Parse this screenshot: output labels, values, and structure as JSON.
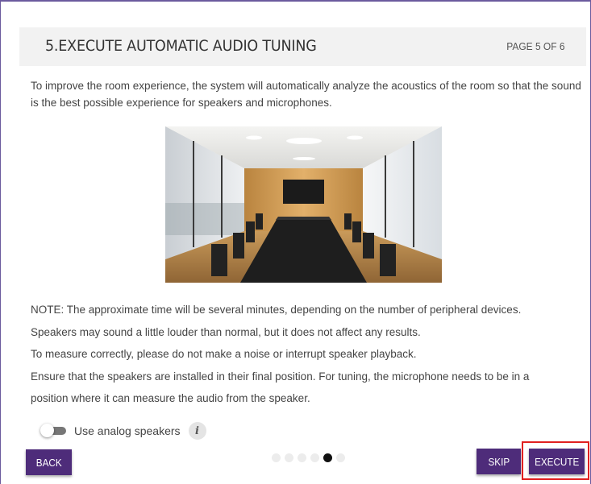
{
  "header": {
    "title": "5.EXECUTE AUTOMATIC AUDIO TUNING",
    "page_indicator": "PAGE 5 OF 6"
  },
  "intro_text": "To improve the room experience, the system will automatically analyze the acoustics of the room so that the sound is the best possible experience for speakers and microphones.",
  "notes": [
    "NOTE: The approximate time will be several minutes, depending on the number of peripheral devices.",
    "Speakers may sound a little louder than normal, but it does not affect any results.",
    "To measure correctly, please do not make a noise or interrupt speaker playback.",
    "Ensure that the speakers are installed in their final position. For tuning, the microphone needs to be in a",
    "position where it can measure the audio from the speaker."
  ],
  "toggle": {
    "label": "Use analog speakers",
    "checked": false,
    "info_icon": "i"
  },
  "pagination": {
    "total": 6,
    "current": 5
  },
  "buttons": {
    "back": "BACK",
    "skip": "SKIP",
    "execute": "EXECUTE"
  },
  "colors": {
    "button": "#4e2c7a",
    "highlight": "#e02020",
    "frame_border": "#6b5a9e"
  }
}
